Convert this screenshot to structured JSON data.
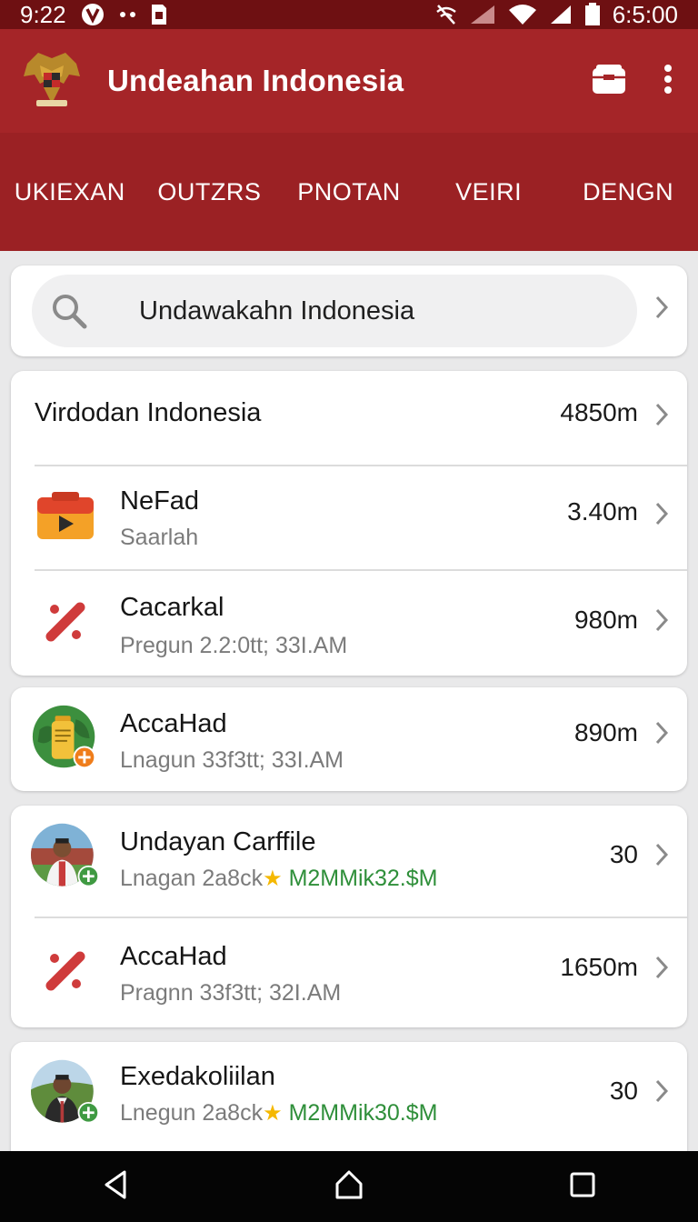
{
  "status_bar": {
    "time": "9:22",
    "clock_right": "6:5:00",
    "icons_left": [
      "vpn-icon",
      "dots-icon",
      "sim-icon"
    ],
    "icons_right": [
      "no-network-icon",
      "signal-icon",
      "wifi-icon",
      "battery-icon"
    ]
  },
  "app_bar": {
    "title": "Undeahan Indonesia",
    "logo": "garuda-emblem-icon",
    "actions": [
      "folder-icon",
      "more-vert-icon"
    ]
  },
  "tabs": [
    "UKIEXAN",
    "OUTZRS",
    "PNOTAN",
    "VEIRI",
    "DENGN"
  ],
  "search": {
    "value": "Undawakahn Indonesia"
  },
  "list": {
    "header": {
      "title": "Virdodan Indonesia",
      "value": "4850m"
    },
    "items": [
      {
        "title": "NeFad",
        "subtitle": "Saarlah",
        "value": "3.40m",
        "icon": "video-folder-icon"
      },
      {
        "title": "Cacarkal",
        "subtitle": "Pregun 2.2:0tt; 33I.AM",
        "value": "980m",
        "icon": "cross-mark-icon"
      },
      {
        "title": "AccaHad",
        "subtitle": "Lnagun 33f3tt; 33I.AM",
        "value": "890m",
        "icon": "bottle-avatar-icon"
      },
      {
        "title": "Undayan Carffile",
        "subtitle": "Lnagan 2a8ck",
        "subtitle_green": "M2MMik32.$M",
        "value": "30",
        "icon": "person-avatar-icon"
      },
      {
        "title": "AccaHad",
        "subtitle": "Pragnn 33f3tt; 32I.AM",
        "value": "1650m",
        "icon": "cross-mark-icon"
      },
      {
        "title": "Exedakoliilan",
        "subtitle": "Lnegun 2a8ck",
        "subtitle_green": "M2MMik30.$M",
        "value": "30",
        "icon": "person-avatar-icon"
      }
    ]
  },
  "nav_bar": [
    "back-icon",
    "home-icon",
    "recents-icon"
  ],
  "colors": {
    "status_bar": "#6e1012",
    "app_bar": "#a52528",
    "tabs": "#9b2124",
    "green_text": "#2f8f3a",
    "background": "#e9e9ea"
  }
}
